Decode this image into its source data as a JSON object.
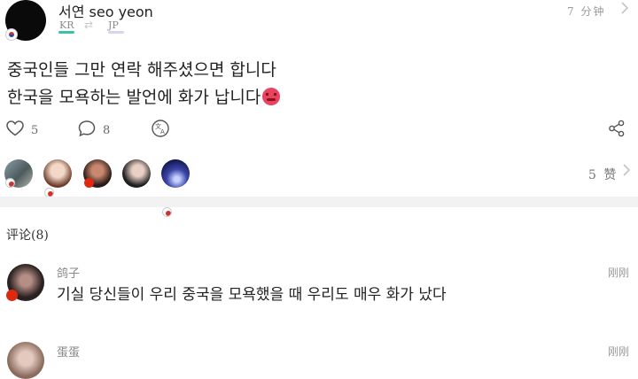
{
  "post": {
    "username": "서연 seo yeon",
    "lang_from": "KR",
    "lang_arrow": "⇄",
    "lang_to": "JP",
    "timestamp": "7 分钟",
    "text_line1": "중국인들 그만 연락 해주셨으면 합니다",
    "text_line2": "한국을 모욕하는 발언에 화가 납니다",
    "emoji_icon": "angry-face-icon",
    "likes": "5",
    "comments": "8",
    "likes_summary": "5 赞"
  },
  "comments_section": {
    "header": "评论(8)",
    "items": [
      {
        "name": "鸽子",
        "time": "刚刚",
        "text": "기실 당신들이 우리 중국을 모욕했을 때 우리도 매우 화가 났다"
      },
      {
        "name": "蛋蛋",
        "time": "刚刚",
        "text": ""
      }
    ]
  },
  "colors": {
    "accent_kr": "#39c3a5",
    "accent_jp": "#d6d6f0",
    "divider": "#f2f2f2",
    "angry_emoji": "#e9445f",
    "china_flag": "#de2910"
  }
}
